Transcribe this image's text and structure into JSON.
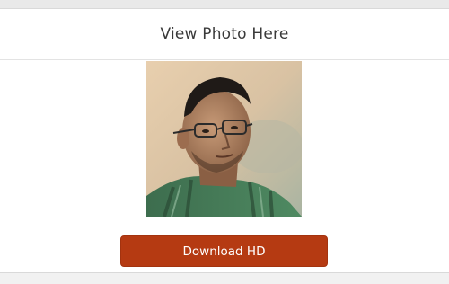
{
  "header": {
    "title": "View Photo Here"
  },
  "photo": {
    "subject": "portrait-photo"
  },
  "actions": {
    "download_label": "Download HD"
  },
  "colors": {
    "button_bg": "#b53a12",
    "page_bg": "#f1f1f1",
    "card_bg": "#ffffff"
  }
}
